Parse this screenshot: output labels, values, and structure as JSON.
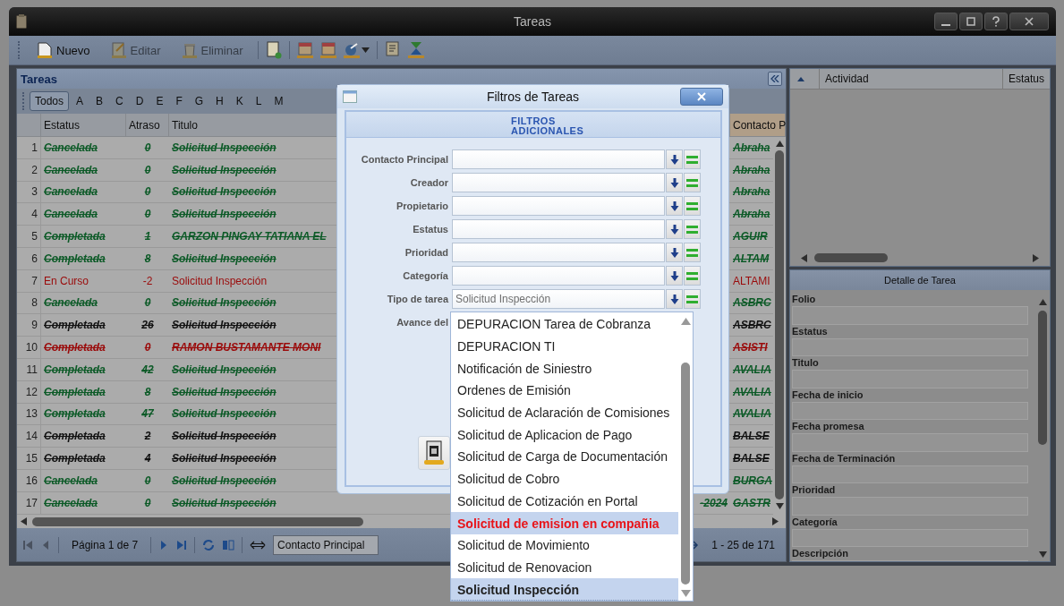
{
  "window": {
    "title": "Tareas"
  },
  "toolbar": [
    {
      "label": "Nuevo",
      "kind": "new",
      "disabled": false
    },
    {
      "label": "Editar",
      "kind": "edit",
      "disabled": true
    },
    {
      "label": "Eliminar",
      "kind": "delete",
      "disabled": true
    }
  ],
  "tasks_panel": {
    "title": "Tareas",
    "letters": [
      {
        "label": "Todos",
        "selected": true
      },
      {
        "label": "A",
        "selected": false
      },
      {
        "label": "B",
        "selected": false
      },
      {
        "label": "C",
        "selected": false
      },
      {
        "label": "D",
        "selected": false
      },
      {
        "label": "E",
        "selected": false
      },
      {
        "label": "F",
        "selected": false
      },
      {
        "label": "G",
        "selected": false
      },
      {
        "label": "H",
        "selected": false
      },
      {
        "label": "K",
        "selected": false
      },
      {
        "label": "L",
        "selected": false
      },
      {
        "label": "M",
        "selected": false
      }
    ]
  },
  "table": {
    "columns": [
      "Estatus",
      "Atraso",
      "Titulo",
      "Contacto P"
    ],
    "rows": [
      {
        "n": "1",
        "status": "Cancelada",
        "delay": "0",
        "title": "Solicitud Inspección",
        "contact": "Abraha",
        "color": "#0c5a27",
        "struck": true
      },
      {
        "n": "2",
        "status": "Cancelada",
        "delay": "0",
        "title": "Solicitud Inspección",
        "contact": "Abraha",
        "color": "#0c5a27",
        "struck": true
      },
      {
        "n": "3",
        "status": "Cancelada",
        "delay": "0",
        "title": "Solicitud Inspección",
        "contact": "Abraha",
        "color": "#0c5a27",
        "struck": true
      },
      {
        "n": "4",
        "status": "Cancelada",
        "delay": "0",
        "title": "Solicitud Inspección",
        "contact": "Abraha",
        "color": "#0c5a27",
        "struck": true
      },
      {
        "n": "5",
        "status": "Completada",
        "delay": "1",
        "title": "GARZON PINGAY TATIANA EL",
        "contact": "AGUIR",
        "color": "#0c5a27",
        "struck": true
      },
      {
        "n": "6",
        "status": "Completada",
        "delay": "8",
        "title": "Solicitud Inspección",
        "contact": "ALTAM",
        "color": "#0c5a27",
        "struck": true
      },
      {
        "n": "7",
        "status": "En Curso",
        "delay": "-2",
        "title": "Solicitud Inspección",
        "contact": "ALTAMI",
        "color": "#9a0a0a",
        "struck": false
      },
      {
        "n": "8",
        "status": "Cancelada",
        "delay": "0",
        "title": "Solicitud Inspección",
        "contact": "ASBRC",
        "color": "#0c5a27",
        "struck": true
      },
      {
        "n": "9",
        "status": "Completada",
        "delay": "26",
        "title": "Solicitud Inspección",
        "contact": "ASBRC",
        "color": "#111111",
        "struck": true
      },
      {
        "n": "10",
        "status": "Completada",
        "delay": "0",
        "title": "RAMON BUSTAMANTE MONI",
        "contact": "ASISTI",
        "color": "#9a0a0a",
        "struck": true
      },
      {
        "n": "11",
        "status": "Completada",
        "delay": "42",
        "title": "Solicitud Inspección",
        "contact": "AVALIA",
        "color": "#0c5a27",
        "struck": true
      },
      {
        "n": "12",
        "status": "Completada",
        "delay": "8",
        "title": "Solicitud Inspección",
        "contact": "AVALIA",
        "color": "#0c5a27",
        "struck": true
      },
      {
        "n": "13",
        "status": "Completada",
        "delay": "47",
        "title": "Solicitud Inspección",
        "contact": "AVALIA",
        "color": "#0c5a27",
        "struck": true
      },
      {
        "n": "14",
        "status": "Completada",
        "delay": "2",
        "title": "Solicitud Inspección",
        "contact": "BALSE",
        "color": "#111111",
        "struck": true
      },
      {
        "n": "15",
        "status": "Completada",
        "delay": "4",
        "title": "Solicitud Inspección",
        "contact": "BALSE",
        "color": "#111111",
        "struck": true
      },
      {
        "n": "16",
        "status": "Cancelada",
        "delay": "0",
        "title": "Solicitud Inspección",
        "contact": "BURGA",
        "color": "#0c5a27",
        "struck": true
      },
      {
        "n": "17",
        "status": "Cancelada",
        "delay": "0",
        "title": "Solicitud Inspección",
        "date": "-2024",
        "contact": "GASTR",
        "color": "#0c5a27",
        "struck": true
      }
    ]
  },
  "pager": {
    "page": "Página 1 de 7",
    "sort_field": "Contacto Principal",
    "range": "1 - 25 de 171"
  },
  "activity_grid": {
    "columns": [
      "Actividad",
      "Estatus"
    ]
  },
  "detail": {
    "title": "Detalle de Tarea",
    "fields": [
      "Folio",
      "Estatus",
      "Titulo",
      "Fecha de inicio",
      "Fecha promesa",
      "Fecha de Terminación",
      "Prioridad",
      "Categoría",
      "Descripción"
    ]
  },
  "dialog": {
    "title": "Filtros de Tareas",
    "section": "FILTROS ADICIONALES",
    "filters": [
      {
        "label": "Contacto Principal"
      },
      {
        "label": "Creador"
      },
      {
        "label": "Propietario"
      },
      {
        "label": "Estatus"
      },
      {
        "label": "Prioridad"
      },
      {
        "label": "Categoría"
      },
      {
        "label": "Tipo de tarea",
        "value": "Solicitud Inspección"
      }
    ],
    "progress_label": "Avance del",
    "options": [
      {
        "label": "DEPURACION Tarea de Cobranza",
        "selected": false,
        "hovered": false
      },
      {
        "label": "DEPURACION TI",
        "selected": false,
        "hovered": false
      },
      {
        "label": "Notificación de Siniestro",
        "selected": false,
        "hovered": false
      },
      {
        "label": "Ordenes de Emisión",
        "selected": false,
        "hovered": false
      },
      {
        "label": "Solicitud de Aclaración de Comisiones",
        "selected": false,
        "hovered": false
      },
      {
        "label": "Solicitud de Aplicacion de Pago",
        "selected": false,
        "hovered": false
      },
      {
        "label": "Solicitud de Carga de Documentación",
        "selected": false,
        "hovered": false
      },
      {
        "label": "Solicitud de Cobro",
        "selected": false,
        "hovered": false
      },
      {
        "label": "Solicitud de Cotización en Portal",
        "selected": false,
        "hovered": false
      },
      {
        "label": "Solicitud de emision en compañia",
        "selected": false,
        "hovered": true
      },
      {
        "label": "Solicitud de Movimiento",
        "selected": false,
        "hovered": false
      },
      {
        "label": "Solicitud de Renovacion",
        "selected": false,
        "hovered": false
      },
      {
        "label": "Solicitud Inspección",
        "selected": true,
        "hovered": false
      }
    ]
  }
}
